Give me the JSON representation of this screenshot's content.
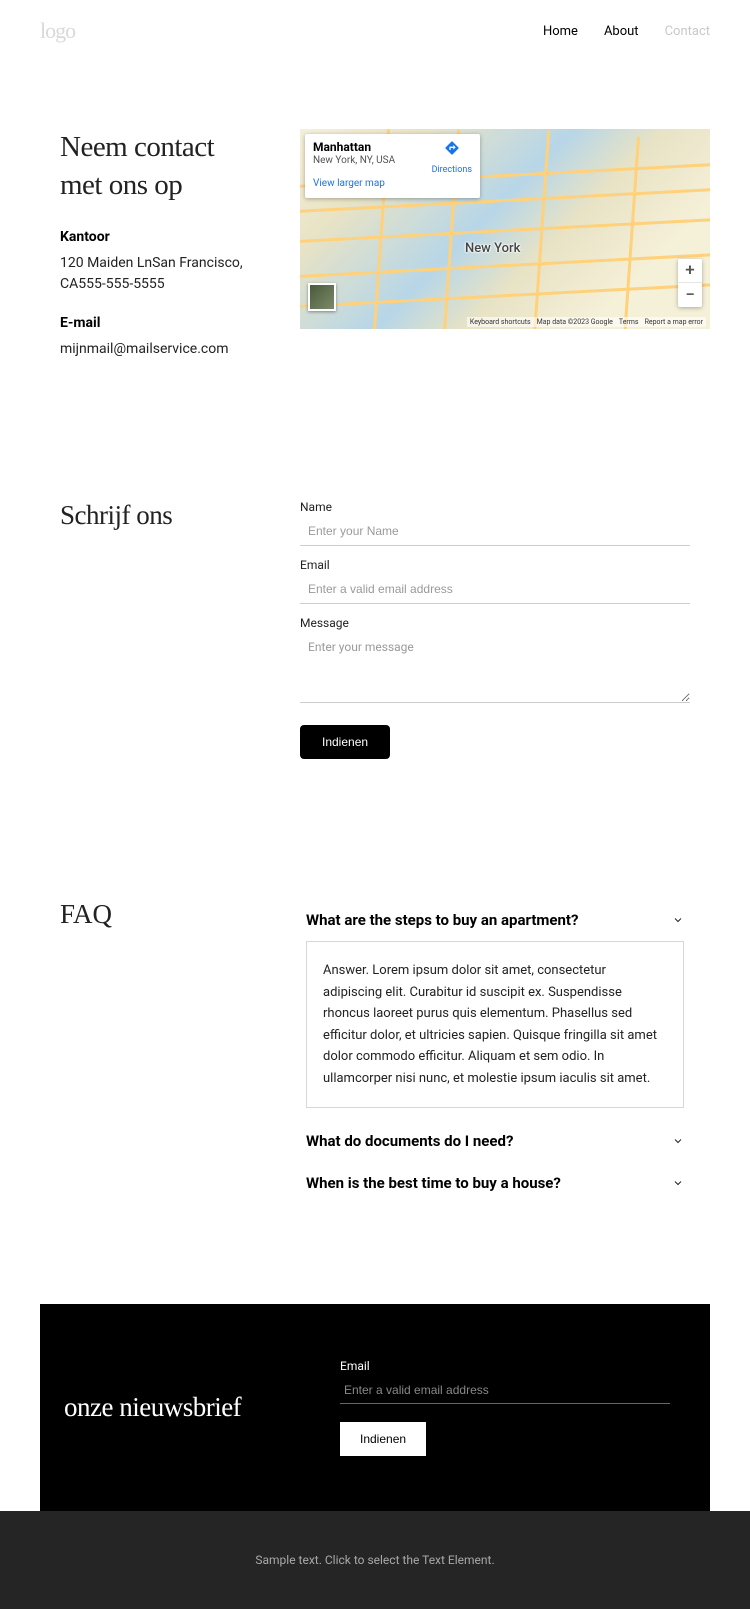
{
  "header": {
    "logo": "logo",
    "nav": [
      "Home",
      "About",
      "Contact"
    ],
    "active_index": 2
  },
  "contact": {
    "heading": "Neem contact met ons op",
    "office_label": "Kantoor",
    "office_value": "120 Maiden LnSan Francisco, CA555-555-5555",
    "email_label": "E-mail",
    "email_value": "mijnmail@mailservice.com"
  },
  "map": {
    "card_title": "Manhattan",
    "card_sub": "New York, NY, USA",
    "directions_label": "Directions",
    "larger_label": "View larger map",
    "city_label": "New York",
    "attrib": [
      "Keyboard shortcuts",
      "Map data ©2023 Google",
      "Terms",
      "Report a map error"
    ]
  },
  "write": {
    "heading": "Schrijf ons",
    "name_label": "Name",
    "name_placeholder": "Enter your Name",
    "email_label": "Email",
    "email_placeholder": "Enter a valid email address",
    "message_label": "Message",
    "message_placeholder": "Enter your message",
    "submit": "Indienen"
  },
  "faq": {
    "heading": "FAQ",
    "items": [
      {
        "q": "What are the steps to buy an apartment?",
        "open": true,
        "a": "Answer. Lorem ipsum dolor sit amet, consectetur adipiscing elit. Curabitur id suscipit ex. Suspendisse rhoncus laoreet purus quis elementum. Phasellus sed efficitur dolor, et ultricies sapien. Quisque fringilla sit amet dolor commodo efficitur. Aliquam et sem odio. In ullamcorper nisi nunc, et molestie ipsum iaculis sit amet."
      },
      {
        "q": "What do documents do I need?",
        "open": false
      },
      {
        "q": "When is the best time to buy a house?",
        "open": false
      }
    ]
  },
  "newsletter": {
    "heading": "onze nieuwsbrief",
    "email_label": "Email",
    "email_placeholder": "Enter a valid email address",
    "submit": "Indienen"
  },
  "footer": {
    "text": "Sample text. Click to select the Text Element."
  }
}
